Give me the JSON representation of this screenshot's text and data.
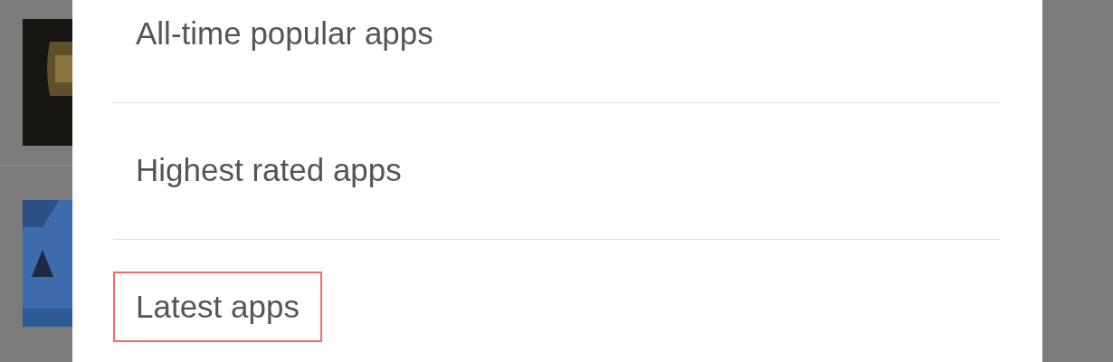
{
  "dialog": {
    "items": [
      {
        "label": "All-time popular apps",
        "highlighted": false
      },
      {
        "label": "Highest rated apps",
        "highlighted": false
      },
      {
        "label": "Latest apps",
        "highlighted": true
      }
    ]
  }
}
